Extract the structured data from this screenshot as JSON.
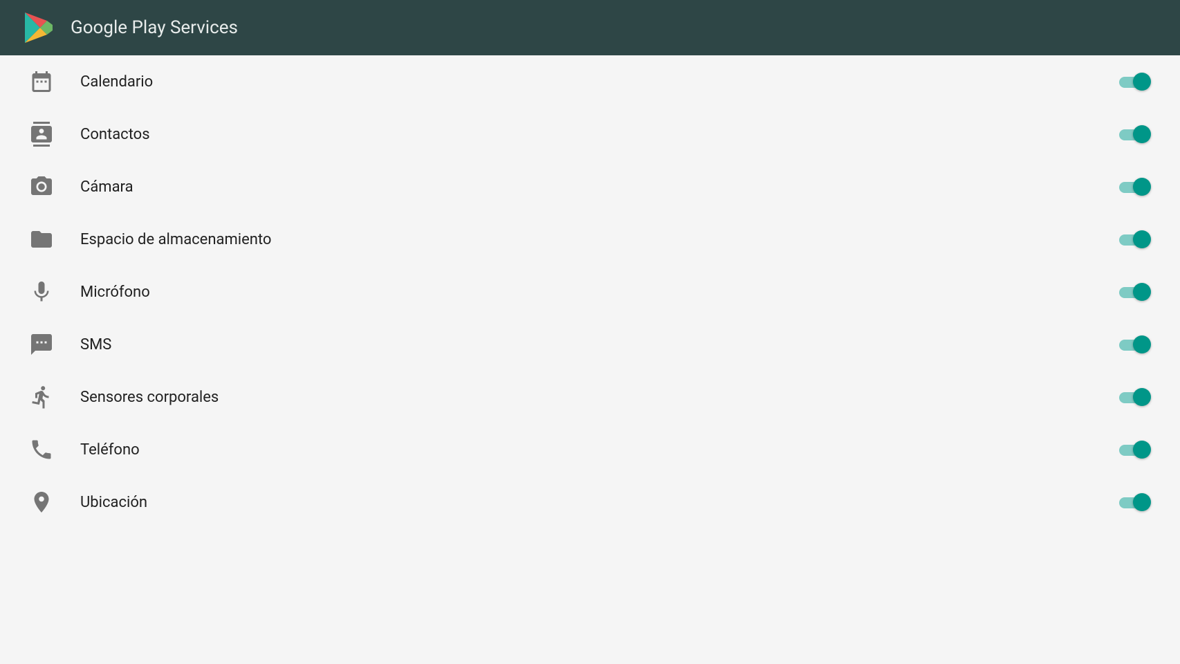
{
  "header": {
    "title": "Google Play Services"
  },
  "permissions": [
    {
      "id": "calendar",
      "label": "Calendario",
      "icon": "calendar",
      "enabled": true
    },
    {
      "id": "contacts",
      "label": "Contactos",
      "icon": "contacts",
      "enabled": true
    },
    {
      "id": "camera",
      "label": "Cámara",
      "icon": "camera",
      "enabled": true
    },
    {
      "id": "storage",
      "label": "Espacio de almacenamiento",
      "icon": "folder",
      "enabled": true
    },
    {
      "id": "microphone",
      "label": "Micrófono",
      "icon": "microphone",
      "enabled": true
    },
    {
      "id": "sms",
      "label": "SMS",
      "icon": "sms",
      "enabled": true
    },
    {
      "id": "body-sensors",
      "label": "Sensores corporales",
      "icon": "body-sensors",
      "enabled": true
    },
    {
      "id": "phone",
      "label": "Teléfono",
      "icon": "phone",
      "enabled": true
    },
    {
      "id": "location",
      "label": "Ubicación",
      "icon": "location",
      "enabled": true
    }
  ]
}
